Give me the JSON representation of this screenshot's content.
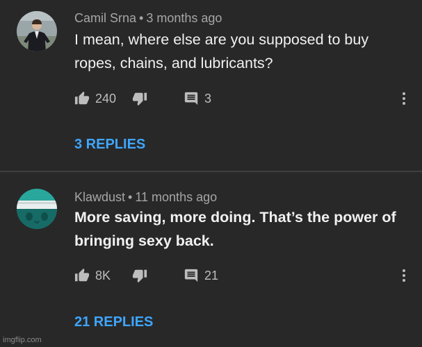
{
  "comments": [
    {
      "author": "Camil Srna",
      "separator": "•",
      "time": "3 months ago",
      "text_line1": "I mean, where else are you supposed to buy",
      "text_line2": "ropes, chains, and lubricants?",
      "likes": "240",
      "replies_count": "3",
      "replies_label": "3 REPLIES",
      "avatar_icon": "person-in-suit-avatar"
    },
    {
      "author": "Klawdust",
      "separator": "•",
      "time": "11 months ago",
      "text_line1": "More saving, more doing. That’s the power of",
      "text_line2": "bringing sexy back.",
      "likes": "8K",
      "replies_count": "21",
      "replies_label": "21 REPLIES",
      "avatar_icon": "bandaged-face-avatar"
    }
  ],
  "icons": {
    "like": "thumb-up-icon",
    "dislike": "thumb-down-icon",
    "reply": "comment-icon",
    "more": "more-vertical-icon"
  },
  "colors": {
    "background": "#282828",
    "link": "#3ea6ff",
    "text": "#f1f1f1",
    "meta": "#a6a6a6"
  },
  "watermark": "imgflip.com"
}
